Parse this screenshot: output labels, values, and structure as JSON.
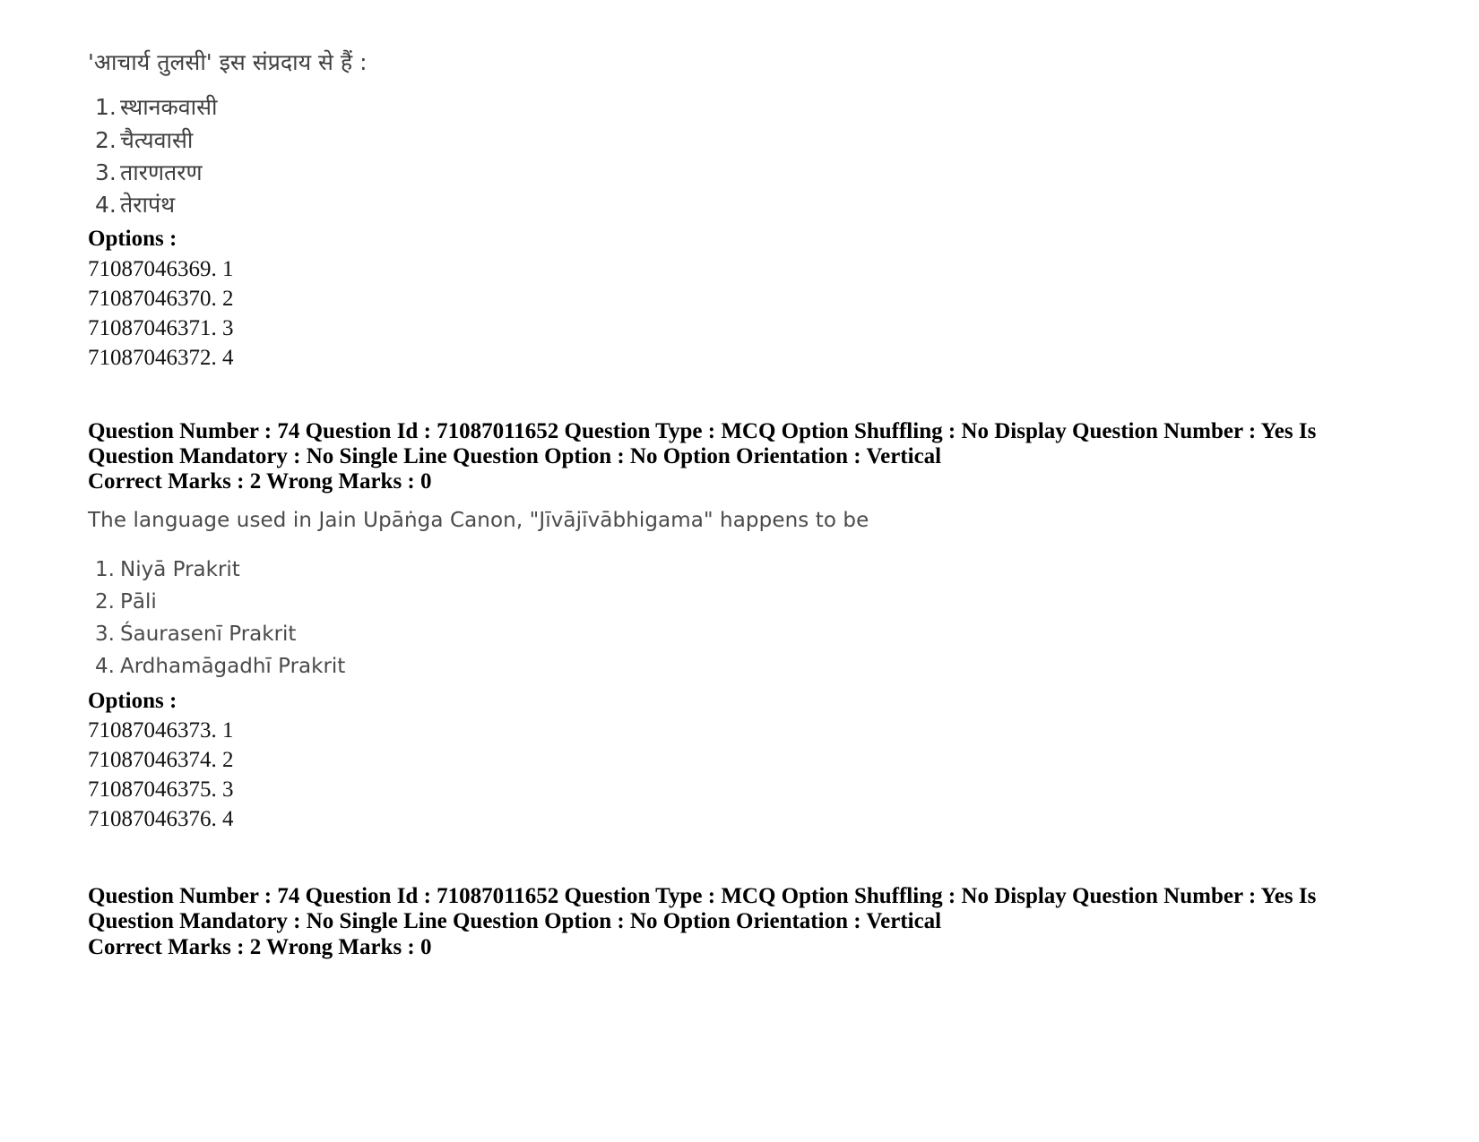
{
  "document": {
    "type": "exam-question-paper"
  },
  "question_hindi": {
    "stem": "'आचार्य तुलसी' इस संप्रदाय से हैं :",
    "options": [
      {
        "num": "1.",
        "text": "स्थानकवासी"
      },
      {
        "num": "2.",
        "text": "चैत्यवासी"
      },
      {
        "num": "3.",
        "text": "तारणतरण"
      },
      {
        "num": "4.",
        "text": "तेरापंथ"
      }
    ],
    "options_label": "Options :",
    "option_ids": [
      "71087046369. 1",
      "71087046370. 2",
      "71087046371. 3",
      "71087046372. 4"
    ]
  },
  "metadata_block_1": {
    "line1": "Question Number : 74 Question Id : 71087011652 Question Type : MCQ Option Shuffling : No Display Question Number : Yes Is",
    "line2": "Question Mandatory : No Single Line Question Option : No Option Orientation : Vertical",
    "line3": "Correct Marks : 2 Wrong Marks : 0"
  },
  "question_english": {
    "stem": "The language used in Jain Upāṅga Canon, \"Jīvājīvābhigama\" happens to be",
    "options": [
      {
        "num": "1.",
        "text": "Niyā Prakrit"
      },
      {
        "num": "2.",
        "text": "Pāli"
      },
      {
        "num": "3.",
        "text": "Śaurasenī Prakrit"
      },
      {
        "num": "4.",
        "text": "Ardhamāgadhī Prakrit"
      }
    ],
    "options_label": "Options :",
    "option_ids": [
      "71087046373. 1",
      "71087046374. 2",
      "71087046375. 3",
      "71087046376. 4"
    ]
  },
  "metadata_block_2": {
    "line1": "Question Number : 74 Question Id : 71087011652 Question Type : MCQ Option Shuffling : No Display Question Number : Yes Is",
    "line2": "Question Mandatory : No Single Line Question Option : No Option Orientation : Vertical",
    "line3": "Correct Marks : 2 Wrong Marks : 0"
  }
}
